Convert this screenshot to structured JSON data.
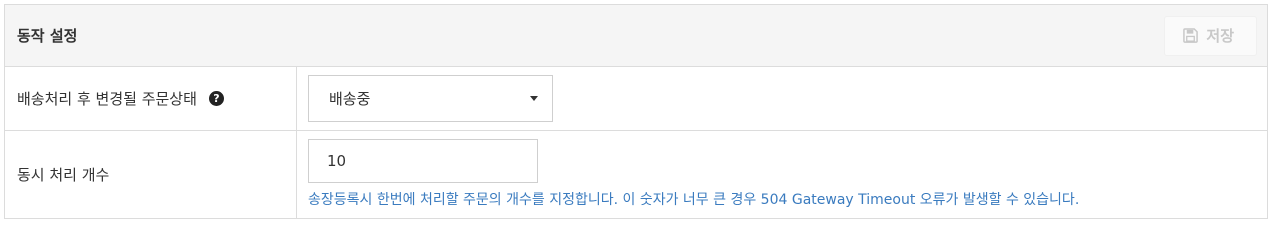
{
  "panel": {
    "title": "동작 설정",
    "save_label": "저장",
    "save_icon": "floppy-disk-icon"
  },
  "rows": [
    {
      "label": "배송처리 후 변경될 주문상태",
      "help_icon": "question-circle-icon",
      "select": {
        "value": "배송중"
      }
    },
    {
      "label": "동시 처리 개수",
      "input": {
        "value": "10"
      },
      "help_text": "송장등록시 한번에 처리할 주문의 개수를 지정합니다. 이 숫자가 너무 큰 경우 504 Gateway Timeout 오류가 발생할 수 있습니다."
    }
  ],
  "colors": {
    "help_text": "#3a7bbf",
    "header_bg": "#f5f5f5",
    "border": "#dcdcdc",
    "save_disabled": "#c8c8c8"
  }
}
